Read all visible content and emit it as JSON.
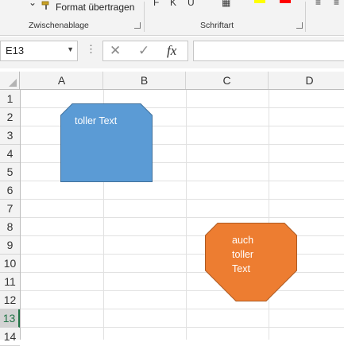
{
  "ribbon": {
    "format_painter_label": "Format übertragen",
    "clipboard_group": "Zwischenablage",
    "font_group": "Schriftart"
  },
  "formula_bar": {
    "name_box_value": "E13",
    "cancel_glyph": "✕",
    "enter_glyph": "✓",
    "fx_glyph": "fx",
    "formula_value": ""
  },
  "sheet": {
    "columns": [
      "A",
      "B",
      "C",
      "D"
    ],
    "rows": [
      "1",
      "2",
      "3",
      "4",
      "5",
      "6",
      "7",
      "8",
      "9",
      "10",
      "11",
      "12",
      "13",
      "14"
    ],
    "active_row": "13"
  },
  "shapes": [
    {
      "lines": [
        "toller Text"
      ],
      "fill": "#5b9bd5",
      "stroke": "#41719c"
    },
    {
      "lines": [
        "auch",
        "toller",
        "Text"
      ],
      "fill": "#ed7d31",
      "stroke": "#ae5a21"
    }
  ],
  "colors": {
    "accent": "#217346",
    "header_bg": "#f3f3f3"
  }
}
